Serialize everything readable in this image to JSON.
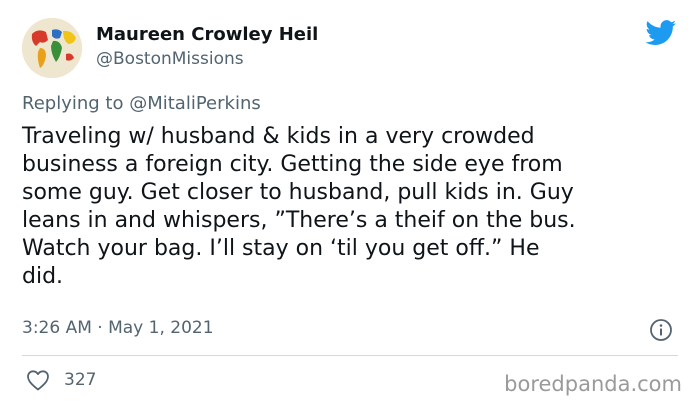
{
  "author": {
    "name": "Maureen Crowley Heil",
    "handle": "@BostonMissions"
  },
  "reply": {
    "prefix": "Replying to",
    "mention": "@MitaliPerkins"
  },
  "tweet": {
    "lines": [
      "Traveling w/ husband & kids in a very crowded",
      "business a foreign city. Getting the side eye from",
      "some guy. Get closer to husband, pull kids in. Guy",
      "leans in and whispers, ”There’s a theif on the bus.",
      "Watch your bag. I’ll stay on ‘til you get off.” He",
      "did."
    ],
    "timestamp": "3:26 AM · May 1, 2021",
    "likes": "327"
  },
  "icons": {
    "brand": "twitter-bird-icon",
    "info": "info-icon",
    "like": "heart-icon"
  },
  "colors": {
    "twitter_blue": "#1d9bf0",
    "secondary_text": "#536471",
    "primary_text": "#0f1419",
    "divider": "#cfd9de"
  },
  "watermark": "boredpanda.com"
}
